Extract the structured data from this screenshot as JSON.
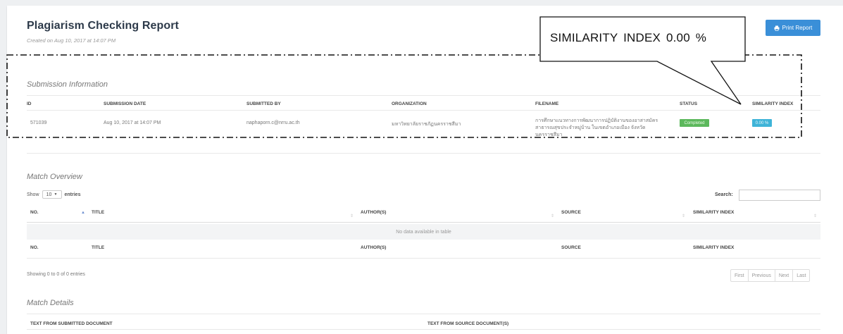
{
  "header": {
    "title": "Plagiarism Checking Report",
    "created": "Created on Aug 10, 2017 at 14:07 PM",
    "print_label": "Print Report"
  },
  "callout": {
    "text": "SIMILARITY INDEX 0.00 %"
  },
  "submission": {
    "heading": "Submission Information",
    "columns": [
      "ID",
      "SUBMISSION DATE",
      "SUBMITTED BY",
      "ORGANIZATION",
      "FILENAME",
      "STATUS",
      "SIMILARITY INDEX"
    ],
    "row": {
      "id": "571039",
      "date": "Aug 10, 2017 at 14:07 PM",
      "submitted_by": "naphaporn.c@nrru.ac.th",
      "organization": "มหาวิทยาลัยราชภัฏนครราชสีมา",
      "filename": "การศึกษาแนวทางการพัฒนาการปฏิบัติงานของอาสาสมัครสาธารณสุขประจำหมู่บ้าน ในเขตอำเภอเมือง จังหวัดนครราชสีมา",
      "status": "Completed",
      "similarity": "0.00 %"
    }
  },
  "match_overview": {
    "heading": "Match Overview",
    "show_label": "Show",
    "entries_value": "10",
    "entries_label": "entries",
    "search_label": "Search:",
    "search_value": "",
    "columns": [
      "NO.",
      "TITLE",
      "AUTHOR(S)",
      "SOURCE",
      "SIMILARITY INDEX"
    ],
    "empty_text": "No data available in table",
    "showing_text": "Showing 0 to 0 of 0 entries",
    "pager": [
      "First",
      "Previous",
      "Next",
      "Last"
    ]
  },
  "match_details": {
    "heading": "Match Details",
    "columns": [
      "TEXT FROM SUBMITTED DOCUMENT",
      "TEXT FROM SOURCE DOCUMENT(S)"
    ]
  },
  "colors": {
    "primary": "#3a8fd8",
    "completed": "#5cb85c",
    "similarity_badge": "#3fb4d8"
  }
}
